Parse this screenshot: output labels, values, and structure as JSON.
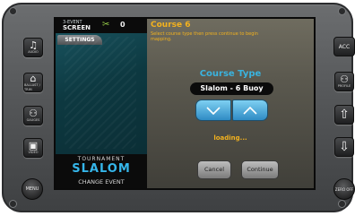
{
  "left_buttons": [
    {
      "icon": "♫",
      "caption": "AUDIO",
      "icon_name": "music-note-icon"
    },
    {
      "icon": "⌂",
      "caption": "BALLAST / TRIM",
      "icon_name": "ballast-icon"
    },
    {
      "icon": "⚇",
      "caption": "GAUGES",
      "icon_name": "gauges-icon"
    },
    {
      "icon": "▣",
      "caption": "VIDEO",
      "icon_name": "video-icon"
    }
  ],
  "menu_label": "MENU",
  "right_buttons": {
    "acc": "ACC",
    "profile_caption": "PROFILE",
    "up_icon": "⇧",
    "down_icon": "⇩",
    "zero_off": "ZERO OFF"
  },
  "screen": {
    "top_bar": {
      "line1": "3-EVENT",
      "line2": "SCREEN",
      "glyph": "✂",
      "counter": "0"
    },
    "settings_tab": "SETTINGS",
    "event": {
      "tournament": "TOURNAMENT",
      "slalom": "SLALOM",
      "change": "CHANGE EVENT"
    },
    "course": {
      "title": "Course 6",
      "instructions": "Select course type then press continue to begin mapping.",
      "type_label": "Course Type",
      "type_value": "Slalom - 6 Buoy",
      "status": "loading...",
      "cancel": "Cancel",
      "continue": "Continue"
    }
  },
  "colors": {
    "accent_orange": "#f3b21e",
    "accent_blue": "#35b6ea",
    "arrow_blue": "#4aa8dc"
  }
}
